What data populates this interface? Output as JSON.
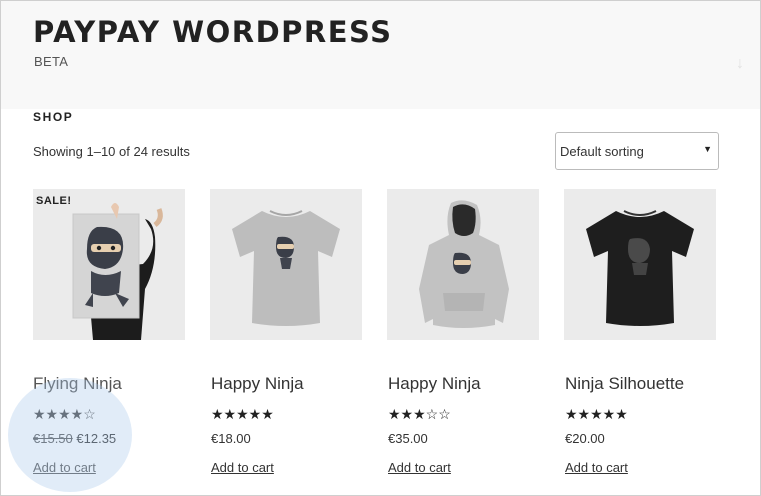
{
  "site": {
    "title": "PAYPAY WORDPRESS",
    "description": "BETA"
  },
  "shop": {
    "page_title": "SHOP",
    "result_count": "Showing 1–10 of 24 results",
    "sorting": {
      "selected": "Default sorting"
    }
  },
  "products": [
    {
      "name": "Flying Ninja",
      "rating": 4,
      "stars": "★★★★☆",
      "sale_badge": "SALE!",
      "old_price": "€15.50",
      "price": "€12.35",
      "cart_label": "Add to cart",
      "image": "poster-ninja"
    },
    {
      "name": "Happy Ninja",
      "rating": 5,
      "stars": "★★★★★",
      "price": "€18.00",
      "cart_label": "Add to cart",
      "image": "tshirt-grey"
    },
    {
      "name": "Happy Ninja",
      "rating": 3,
      "stars": "★★★☆☆",
      "price": "€35.00",
      "cart_label": "Add to cart",
      "image": "hoodie-grey"
    },
    {
      "name": "Ninja Silhouette",
      "rating": 5,
      "stars": "★★★★★",
      "price": "€20.00",
      "cart_label": "Add to cart",
      "image": "tshirt-black"
    }
  ],
  "icons": {
    "scroll_down": "arrow-down-icon",
    "sort_caret": "caret-down-icon"
  },
  "colors": {
    "header_bg": "#f8f8f8",
    "thumb_bg": "#ebebeb",
    "click_highlight": "#aac8eb"
  }
}
